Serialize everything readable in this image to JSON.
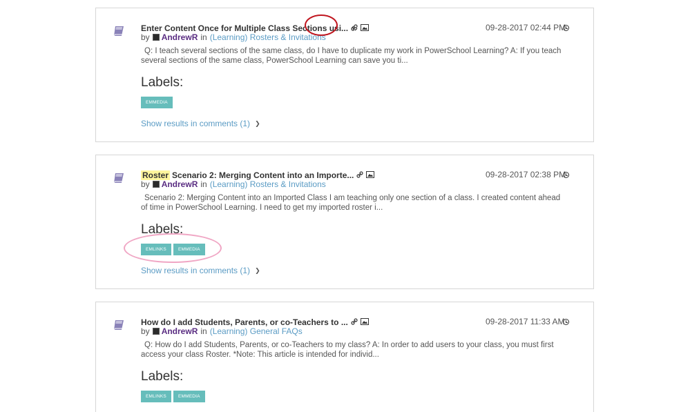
{
  "results": [
    {
      "highlight": "",
      "title": "Enter Content Once for Multiple Class Sections usi...",
      "by": "by",
      "author": "AndrewR",
      "in": "in",
      "board": "(Learning) Rosters & Invitations",
      "excerpt": "Q: I teach several sections of the same class, do I have to duplicate my work in PowerSchool Learning? A: If you teach several sections of the same class, PowerSchool Learning can save you ti...",
      "labels_heading": "Labels:",
      "labels": [
        "EMMEDIA"
      ],
      "show_comments": "Show results in comments (1)",
      "date": "09-28-2017 02:44 PM"
    },
    {
      "highlight": "Roster",
      "title": "Scenario 2: Merging Content into an Importe...",
      "by": "by",
      "author": "AndrewR",
      "in": "in",
      "board": "(Learning) Rosters & Invitations",
      "excerpt": "Scenario 2: Merging Content into an Imported Class  I am teaching only one section of a class. I created content ahead of time in PowerSchool Learning. I need to get my imported roster i...",
      "labels_heading": "Labels:",
      "labels": [
        "EMLINKS",
        "EMMEDIA"
      ],
      "show_comments": "Show results in comments (1)",
      "date": "09-28-2017 02:38 PM"
    },
    {
      "highlight": "",
      "title": "How do I add Students, Parents, or co-Teachers to ...",
      "by": "by",
      "author": "AndrewR",
      "in": "in",
      "board": "(Learning) General FAQs",
      "excerpt": "Q: How do I add Students, Parents, or co-Teachers to my class? A: In order to add users to your class, you must first access your class Roster. *Note: This article is intended for individ...",
      "labels_heading": "Labels:",
      "labels": [
        "EMLINKS",
        "EMMEDIA"
      ],
      "show_comments": "",
      "date": "09-28-2017 11:33 AM"
    }
  ],
  "icons": {
    "kind": "book-icon",
    "link": "link-icon",
    "image": "image-icon",
    "clock": "clock-icon",
    "chevron": "chevron-right-icon"
  },
  "colors": {
    "tag_bg": "#66bdbb",
    "link": "#5a9bc4",
    "author": "#5a2d82",
    "highlight": "#fff59d",
    "annotation_red": "#c0151e",
    "annotation_pink": "#f0a6c4"
  }
}
